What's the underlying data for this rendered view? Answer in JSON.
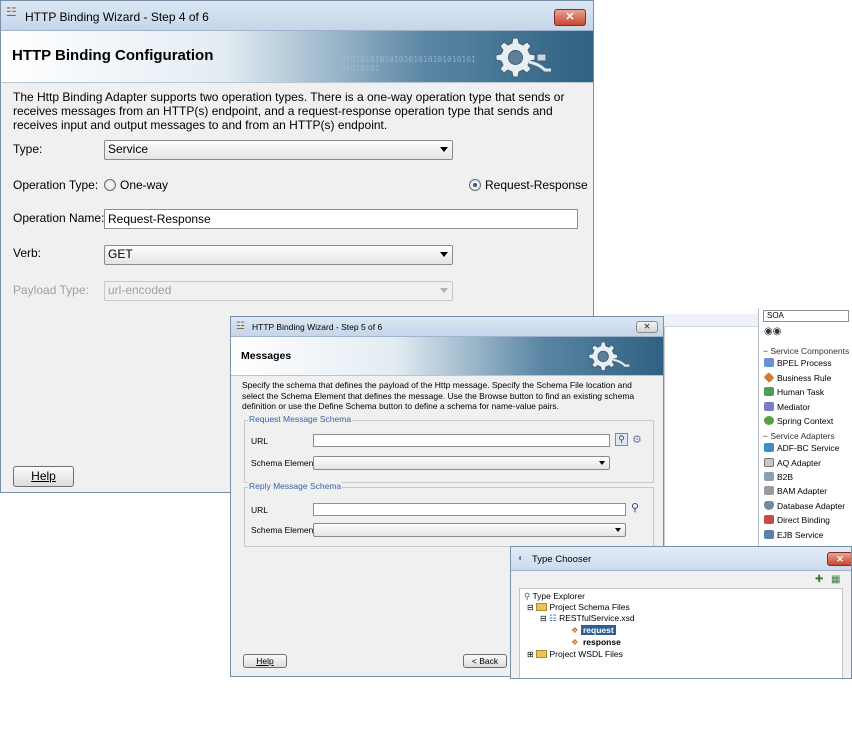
{
  "step4": {
    "title": "HTTP Binding Wizard - Step 4 of 6",
    "header": "HTTP Binding Configuration",
    "banner_bits": "0101010101010101010101010101\n01010101",
    "description": "The Http Binding Adapter supports two operation types.  There is a one-way operation type that sends or receives messages from an HTTP(s) endpoint, and a request-response operation type that sends and receives input and output messages to and from an HTTP(s) endpoint.",
    "type_label": "Type:",
    "type_value": "Service",
    "operation_type_label": "Operation Type:",
    "option_one_way": "One-way",
    "option_request_response": "Request-Response",
    "selected_operation": "Request-Response",
    "operation_name_label": "Operation Name:",
    "operation_name_value": "Request-Response",
    "verb_label": "Verb:",
    "verb_value": "GET",
    "payload_type_label": "Payload Type:",
    "payload_type_value": "url-encoded",
    "help_label": "Help",
    "close_glyph": "✕"
  },
  "step5": {
    "title": "HTTP Binding Wizard - Step 5 of 6",
    "header": "Messages",
    "description": "Specify the schema that defines the payload of the Http message.  Specify the Schema File location and select the Schema Element that defines the message. Use the Browse button to find an existing schema definition or use the Define Schema button to define a schema for name-value pairs.",
    "request_group": "Request Message Schema",
    "reply_group": "Reply Message Schema",
    "url_label": "URL",
    "schema_element_label": "Schema Element",
    "url_value": "",
    "schema_element_value": "",
    "help_label": "Help",
    "back_label": "< Back",
    "close_glyph": "✕"
  },
  "palette": {
    "search_value": "SOA",
    "section_components": "Service Components",
    "components": [
      "BPEL Process",
      "Business Rule",
      "Human Task",
      "Mediator",
      "Spring Context"
    ],
    "section_adapters": "Service Adapters",
    "adapters": [
      "ADF-BC Service",
      "AQ Adapter",
      "B2B",
      "BAM Adapter",
      "Database Adapter",
      "Direct Binding",
      "EJB Service"
    ],
    "colors": {
      "bpel": "#6a8fd0",
      "rule": "#d07a3a",
      "task": "#4aa05a",
      "mediator": "#7a7ac8",
      "spring": "#5aa040"
    }
  },
  "type_chooser": {
    "title": "Type Chooser",
    "close_glyph": "✕",
    "tree": {
      "root": "Type Explorer",
      "project_schema_files": "Project Schema Files",
      "xsd_file": "RESTfulService.xsd",
      "element_request": "request",
      "element_response": "response",
      "project_wsdl_files": "Project WSDL Files"
    }
  }
}
